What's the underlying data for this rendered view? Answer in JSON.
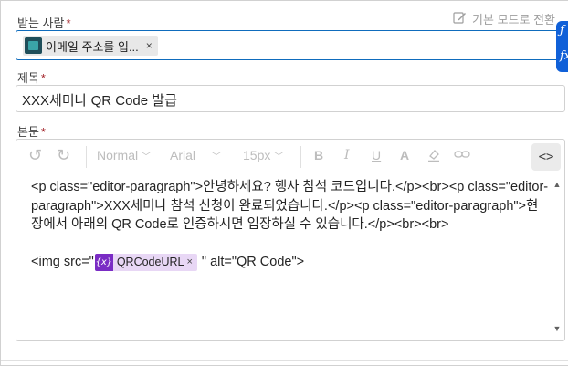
{
  "to_field": {
    "label": "받는 사람",
    "required_mark": "*",
    "switch_link": "기본 모드로 전환",
    "chip_text": "이메일 주소를 입...",
    "chip_remove": "×"
  },
  "side_panel": {
    "icon_top": "ƒ",
    "icon_bottom": "fx"
  },
  "subject_field": {
    "label": "제목",
    "required_mark": "*",
    "value": "XXX세미나 QR Code 발급"
  },
  "body_field": {
    "label": "본문",
    "required_mark": "*",
    "toolbar": {
      "undo_icon": "↺",
      "redo_icon": "↻",
      "style_select": "Normal",
      "font_select": "Arial",
      "size_select": "15px",
      "bold": "B",
      "italic": "I",
      "underline": "U",
      "font_color": "A",
      "highlight_icon": "⌂",
      "link_icon": "⊖",
      "code_view": "<>"
    },
    "html_line1": "<p class=\"editor-paragraph\">안녕하세요? 행사 참석 코드입니다.</p><br><p class=\"editor-paragraph\">XXX세미나 참석 신청이 완료되었습니다.</p><p class=\"editor-paragraph\">현장에서 아래의 QR Code로 인증하시면 입장하실 수 있습니다.</p><br><br>",
    "img_prefix": "<img src=\"",
    "token_icon": "{x}",
    "token_label": "QRCodeURL",
    "token_remove": "×",
    "img_suffix": "\" alt=\"QR Code\">",
    "scroll_up": "▲",
    "scroll_down": "▼"
  },
  "colors": {
    "accent": "#0f6cbd",
    "required": "#a4262c",
    "token_bg": "#e8d7f5",
    "token_icon_bg": "#7a2cc4",
    "side_panel": "#1060d8"
  }
}
